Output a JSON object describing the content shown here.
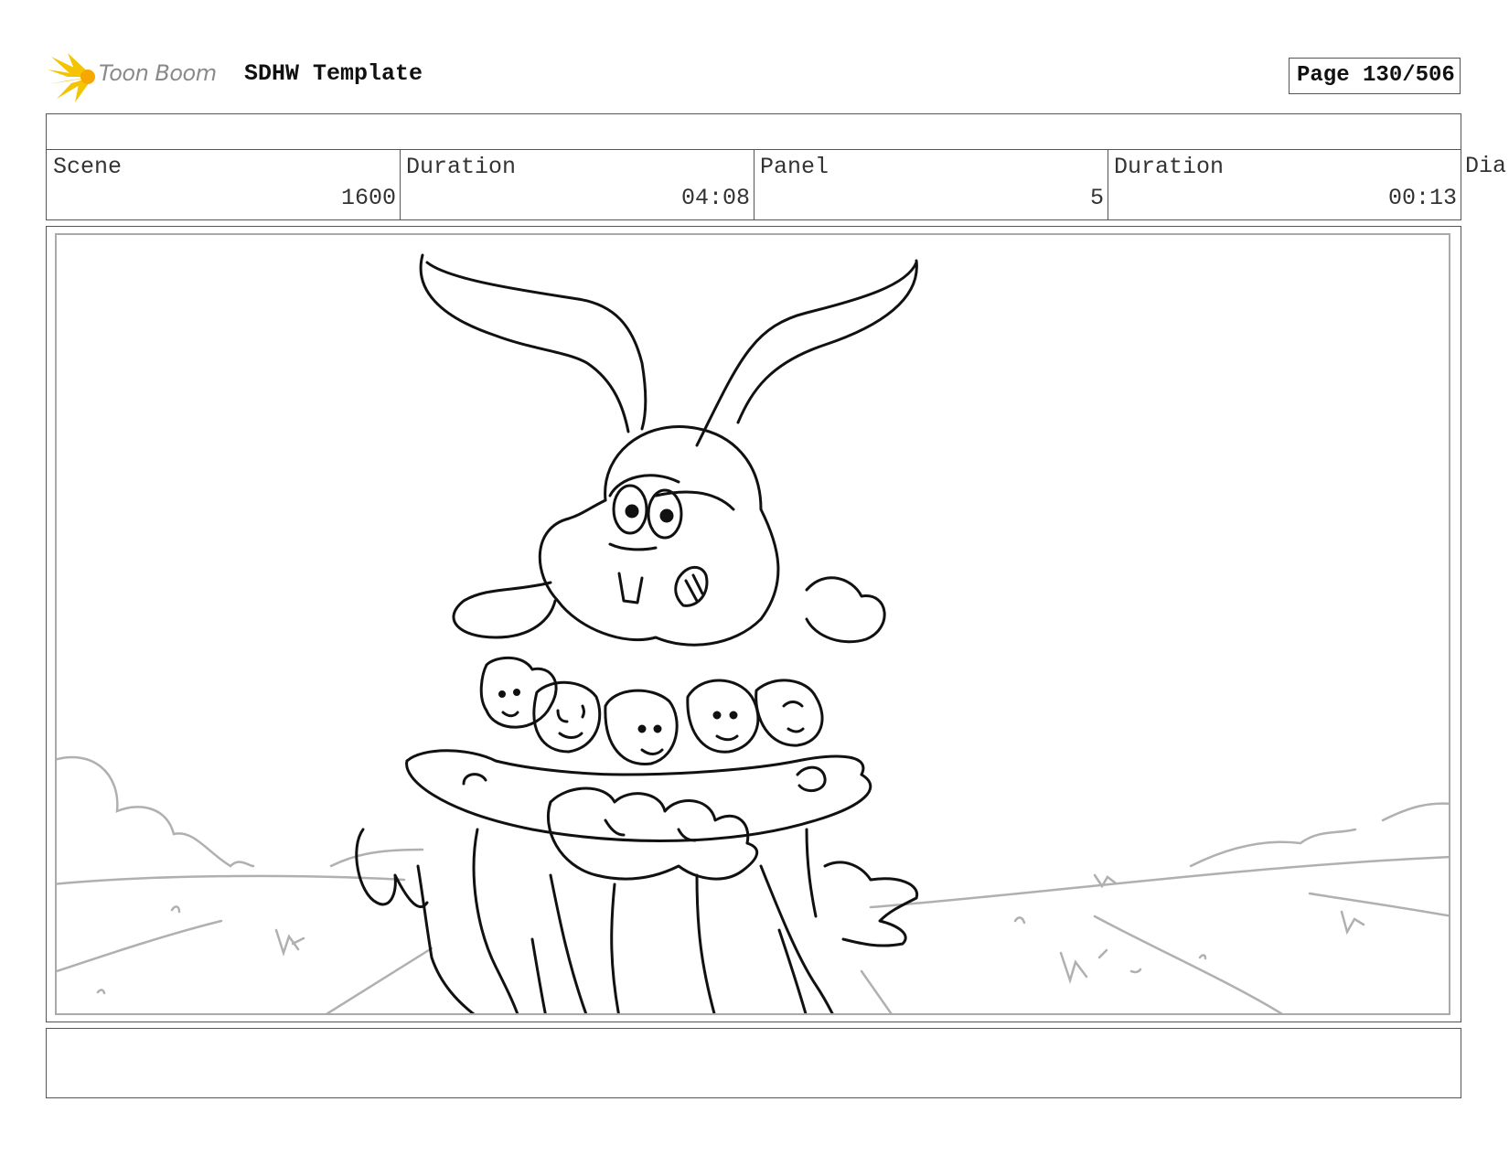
{
  "header": {
    "brand": "Toon Boom",
    "document_title": "SDHW Template",
    "page_label": "Page 130/506"
  },
  "info": {
    "scene_label": "Scene",
    "scene_value": "1600",
    "scene_duration_label": "Duration",
    "scene_duration_value": "04:08",
    "panel_label": "Panel",
    "panel_value": "5",
    "panel_duration_label": "Duration",
    "panel_duration_value": "00:13",
    "dialogue_label": "Dia"
  },
  "colors": {
    "logo_yellow": "#f5c400",
    "sketch_line": "#111111",
    "background_line": "#b0b0b0"
  }
}
